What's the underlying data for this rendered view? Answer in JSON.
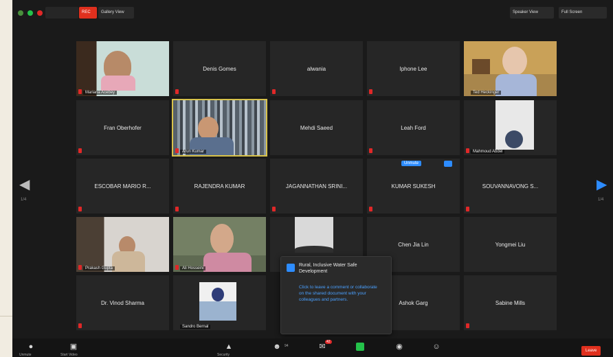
{
  "meeting": {
    "recording_label": "REC",
    "view_label": "Gallery View",
    "speaker_view_label": "Speaker View",
    "fullscreen_label": "Full Screen"
  },
  "colors": {
    "accent": "#2d8cff",
    "mic_off": "#e02828",
    "leave": "#e0301e"
  },
  "nav": {
    "left_page": "1/4",
    "right_page": "1/4"
  },
  "tiles": [
    {
      "name": "Mariana Acebey",
      "type": "video"
    },
    {
      "name": "Denis Gomes",
      "type": "name"
    },
    {
      "name": "alwania",
      "type": "name"
    },
    {
      "name": "Iphone Lee",
      "type": "name"
    },
    {
      "name": "Ted Heckinger",
      "type": "video"
    },
    {
      "name": "Fran Oberhofer",
      "type": "name"
    },
    {
      "name": "Arun Kumar",
      "type": "video"
    },
    {
      "name": "Mehdi Saeed",
      "type": "name"
    },
    {
      "name": "Leah Ford",
      "type": "name"
    },
    {
      "name": "Mahmoud Abdel",
      "type": "video"
    },
    {
      "name": "ESCOBAR MARIO R...",
      "type": "name"
    },
    {
      "name": "RAJENDRA KUMAR",
      "type": "name"
    },
    {
      "name": "JAGANNATHAN SRINI...",
      "type": "name"
    },
    {
      "name": "KUMAR SUKESH",
      "type": "name"
    },
    {
      "name": "SOUVANNAVONG S...",
      "type": "name"
    },
    {
      "name": "Prakash Gupta",
      "type": "video"
    },
    {
      "name": "Ali Hosseini",
      "type": "video"
    },
    {
      "name": "",
      "type": "video"
    },
    {
      "name": "Chen Jia Lin",
      "type": "name"
    },
    {
      "name": "Yongmei Liu",
      "type": "name"
    },
    {
      "name": "Dr. Vinod Sharma",
      "type": "name"
    },
    {
      "name": "Sandro Bernal",
      "type": "video"
    },
    {
      "name": "",
      "type": "name"
    },
    {
      "name": "Ashok Garg",
      "type": "name"
    },
    {
      "name": "Sabine Mills",
      "type": "name"
    }
  ],
  "speaker_badge": "Unmute",
  "popup": {
    "title": "Rural, Inclusive Water Safe Development",
    "body": "Click to leave a comment or collaborate on the shared document with your colleagues and partners."
  },
  "toolbar": {
    "items": [
      {
        "label": "Unmute",
        "icon": "microphone-icon"
      },
      {
        "label": "Start Video",
        "icon": "video-icon"
      },
      {
        "label": "Security",
        "icon": "shield-icon"
      },
      {
        "label": "Participants",
        "icon": "participants-icon",
        "count": "94"
      },
      {
        "label": "Chat",
        "icon": "chat-icon",
        "badge": "42"
      },
      {
        "label": "Share Screen",
        "icon": "share-icon"
      },
      {
        "label": "Record",
        "icon": "record-icon"
      },
      {
        "label": "Reactions",
        "icon": "reactions-icon"
      }
    ],
    "leave_label": "Leave"
  }
}
